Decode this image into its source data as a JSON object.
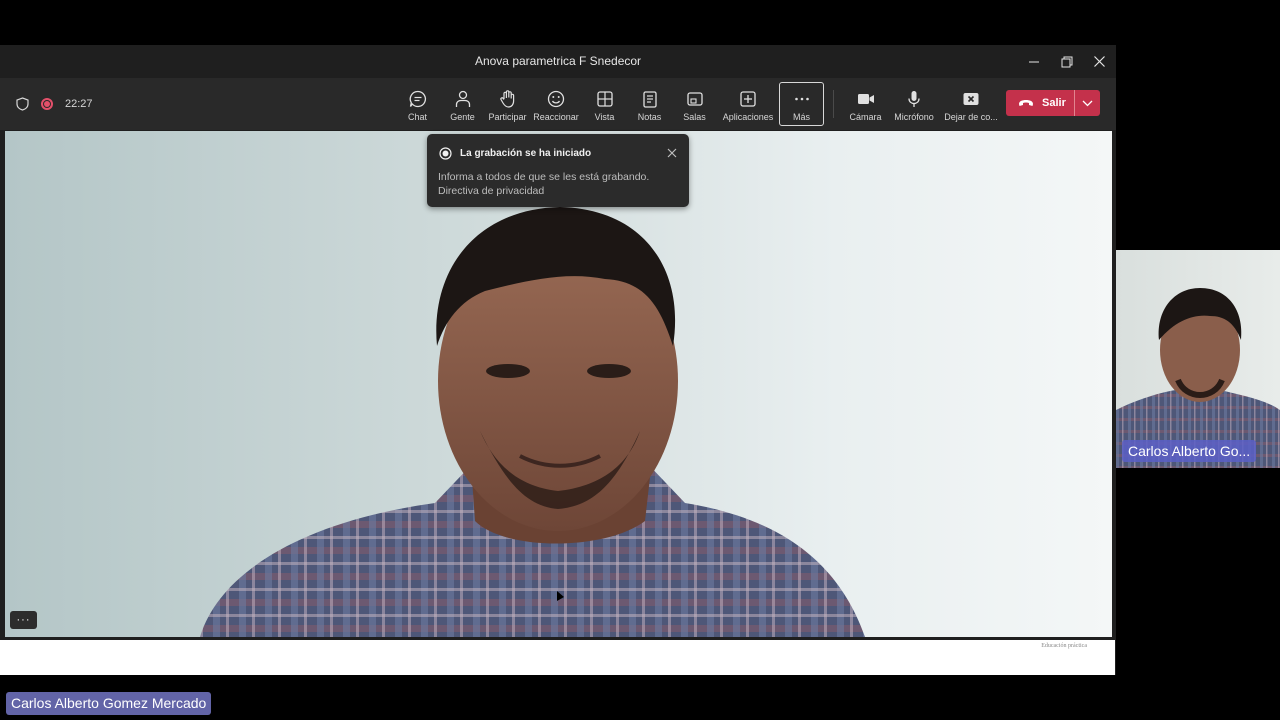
{
  "window": {
    "title": "Anova parametrica F Snedecor"
  },
  "meeting": {
    "timer": "22:27"
  },
  "toolbar": {
    "items": [
      {
        "label": "Chat",
        "icon": "chat-icon"
      },
      {
        "label": "Gente",
        "icon": "people-icon"
      },
      {
        "label": "Participar",
        "icon": "raise-hand-icon"
      },
      {
        "label": "Reaccionar",
        "icon": "smiley-icon"
      },
      {
        "label": "Vista",
        "icon": "grid-icon"
      },
      {
        "label": "Notas",
        "icon": "notes-icon"
      },
      {
        "label": "Salas",
        "icon": "rooms-icon"
      },
      {
        "label": "Aplicaciones",
        "icon": "add-apps-icon"
      },
      {
        "label": "Más",
        "icon": "more-icon"
      },
      {
        "label": "Cámara",
        "icon": "camera-icon"
      },
      {
        "label": "Micrófono",
        "icon": "microphone-icon"
      },
      {
        "label": "Dejar de co...",
        "icon": "stop-share-icon"
      }
    ],
    "leave_label": "Salir"
  },
  "notification": {
    "title": "La grabación se ha iniciado",
    "body": "Informa a todos de que se les está grabando.",
    "link": "Directiva de privacidad"
  },
  "stage": {
    "more_label": "···"
  },
  "slide_strip": {
    "footer_text": "Educación práctica"
  },
  "participants": {
    "thumbnail_name": "Carlos Alberto Go...",
    "presenter_name": "Carlos Alberto Gomez Mercado"
  },
  "colors": {
    "leave": "#c4314b",
    "recording": "#e3506a",
    "name_badge": "#6264a7"
  }
}
